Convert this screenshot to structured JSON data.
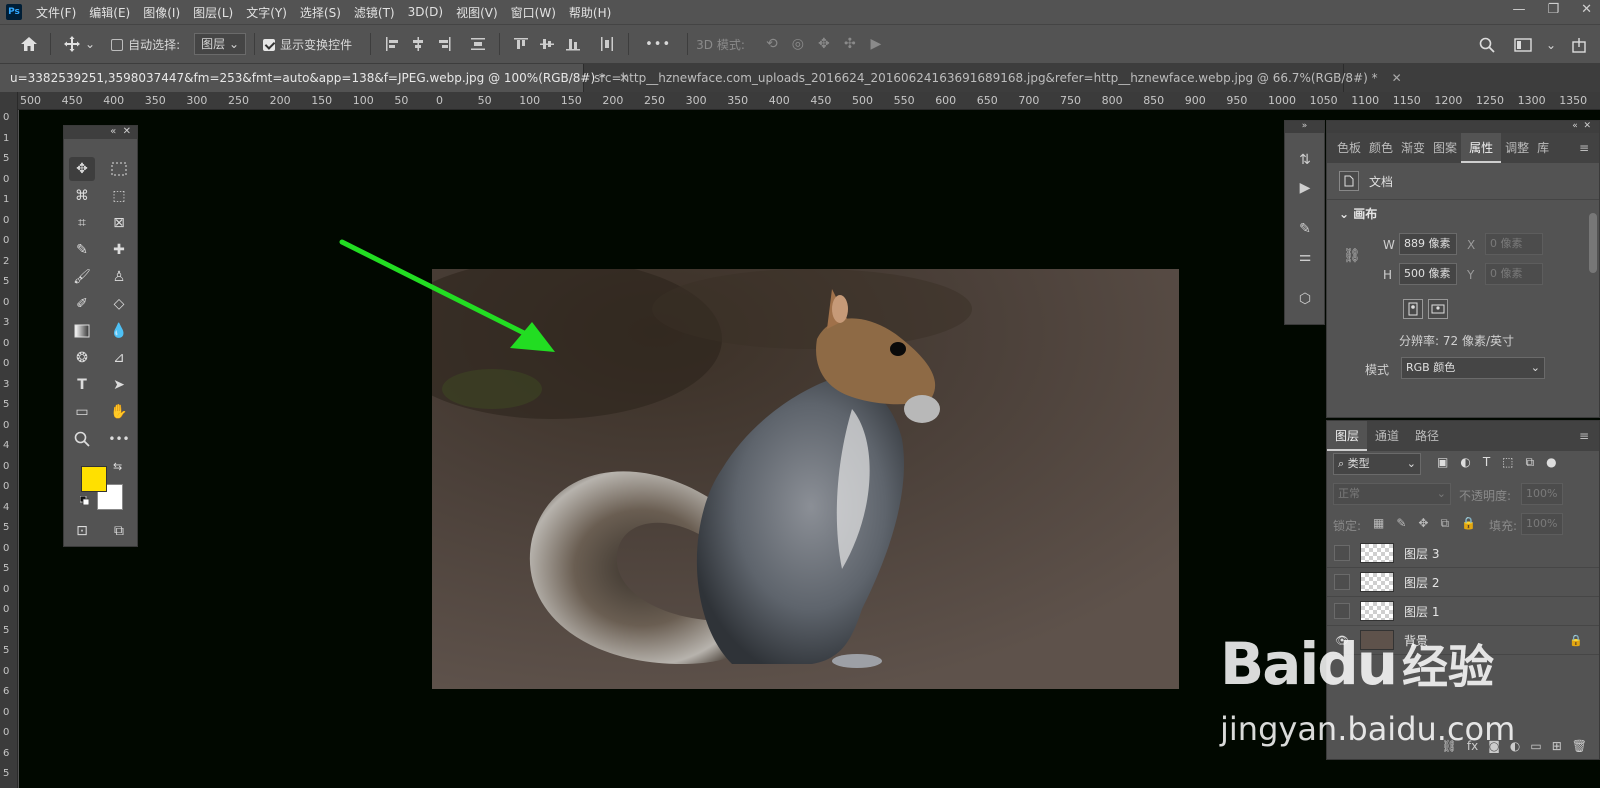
{
  "app": {
    "logo": "Ps"
  },
  "menu": [
    "文件(F)",
    "编辑(E)",
    "图像(I)",
    "图层(L)",
    "文字(Y)",
    "选择(S)",
    "滤镜(T)",
    "3D(D)",
    "视图(V)",
    "窗口(W)",
    "帮助(H)"
  ],
  "window_controls": {
    "minimize": "—",
    "restore": "❐",
    "close": "✕"
  },
  "options": {
    "auto_select_label": "自动选择:",
    "auto_select_target": "图层",
    "show_transform_label": "显示变换控件",
    "three_d_mode_label": "3D 模式:",
    "more": "•••"
  },
  "tabs": [
    {
      "title": "u=3382539251,3598037447&fm=253&fmt=auto&app=138&f=JPEG.webp.jpg @ 100%(RGB/8#) *",
      "close": "✕"
    },
    {
      "title": "src=http__hznewface.com_uploads_2016624_20160624163691689168.jpg&refer=http__hznewface.webp.jpg @ 66.7%(RGB/8#) *",
      "close": "✕"
    }
  ],
  "ruler_h": [
    "500",
    "450",
    "400",
    "350",
    "300",
    "250",
    "200",
    "150",
    "100",
    "50",
    "0",
    "50",
    "100",
    "150",
    "200",
    "250",
    "300",
    "350",
    "400",
    "450",
    "500",
    "550",
    "600",
    "650",
    "700",
    "750",
    "800",
    "850",
    "900",
    "950",
    "1000",
    "1050",
    "1100",
    "1150",
    "1200",
    "1250",
    "1300",
    "1350"
  ],
  "ruler_v": [
    "0",
    "1",
    "5",
    "0",
    "1",
    "0",
    "0",
    "2",
    "5",
    "0",
    "3",
    "0",
    "0",
    "3",
    "5",
    "0",
    "4",
    "0",
    "0",
    "4",
    "5",
    "0",
    "5",
    "0",
    "0",
    "5",
    "5",
    "0",
    "6",
    "0",
    "0",
    "6",
    "5"
  ],
  "colors": {
    "foreground": "#ffe000",
    "background": "#ffffff",
    "arrow": "#22dd22",
    "canvas_bg": "#010800"
  },
  "properties_panel": {
    "tabs": [
      "色板",
      "颜色",
      "渐变",
      "图案",
      "属性",
      "调整",
      "库"
    ],
    "active_tab": "属性",
    "doc_label": "文档",
    "canvas_section": "画布",
    "w_label": "W",
    "w_value": "889 像素",
    "h_label": "H",
    "h_value": "500 像素",
    "x_label": "X",
    "x_value": "0 像素",
    "y_label": "Y",
    "y_value": "0 像素",
    "resolution": "分辨率: 72 像素/英寸",
    "mode_label": "模式",
    "mode_value": "RGB 颜色"
  },
  "layers_panel": {
    "tabs": [
      "图层",
      "通道",
      "路径"
    ],
    "filter_label": "类型",
    "blend_mode": "正常",
    "opacity_label": "不透明度:",
    "opacity_value": "100%",
    "lock_label": "锁定:",
    "fill_label": "填充:",
    "fill_value": "100%",
    "layers": [
      {
        "name": "图层 3"
      },
      {
        "name": "图层 2"
      },
      {
        "name": "图层 1"
      },
      {
        "name": "背景"
      }
    ]
  },
  "watermark": {
    "brand": "Baidu",
    "brand_suffix": "经验",
    "url": "jingyan.baidu.com"
  }
}
